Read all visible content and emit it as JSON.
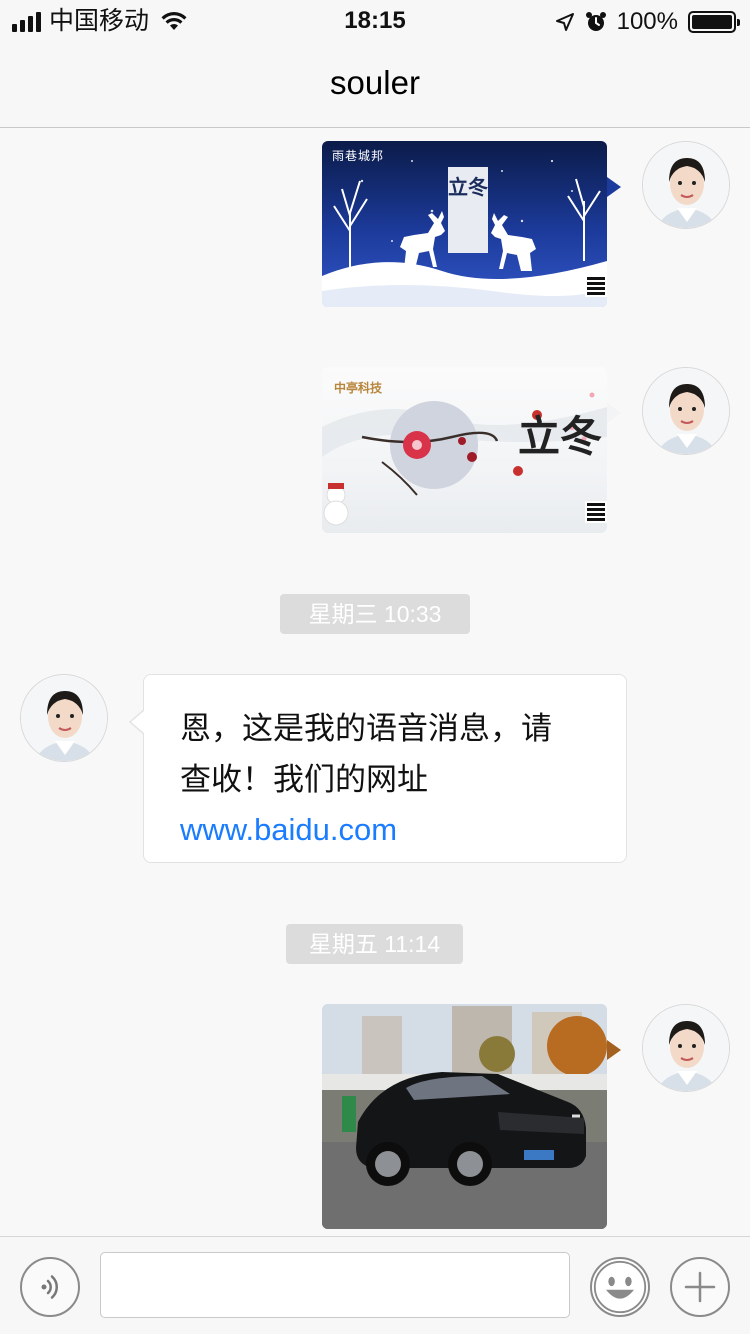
{
  "status_bar": {
    "carrier": "中国移动",
    "time": "18:15",
    "battery_percent": "100%",
    "battery_level": 1.0,
    "icons": [
      "signal-icon",
      "wifi-icon",
      "location-arrow-icon",
      "alarm-icon",
      "battery-icon"
    ]
  },
  "nav": {
    "title": "souler"
  },
  "messages": [
    {
      "type": "image",
      "side": "right",
      "brand": "雨巷城邦",
      "poster_title": "立冬",
      "image_desc_name": "winter-deer-poster"
    },
    {
      "type": "image",
      "side": "right",
      "brand": "中亭科技",
      "poster_title": "立冬",
      "image_desc_name": "plum-blossom-poster"
    },
    {
      "type": "timestamp",
      "text": "星期三 10:33"
    },
    {
      "type": "text",
      "side": "left",
      "line1": "恩，这是我的语音消息，请",
      "line2": "查收！我们的网址",
      "link": "www.baidu.com"
    },
    {
      "type": "timestamp",
      "text": "星期五 11:14"
    },
    {
      "type": "image",
      "side": "right",
      "image_desc_name": "black-sedan-photo"
    }
  ],
  "input_bar": {
    "value": "",
    "placeholder": "",
    "icons": [
      "voice-icon",
      "emoji-icon",
      "plus-icon"
    ]
  },
  "colors": {
    "link": "#1a7cff",
    "background": "#f8f8f8",
    "timestamp_bg": "#dcdcdc"
  }
}
